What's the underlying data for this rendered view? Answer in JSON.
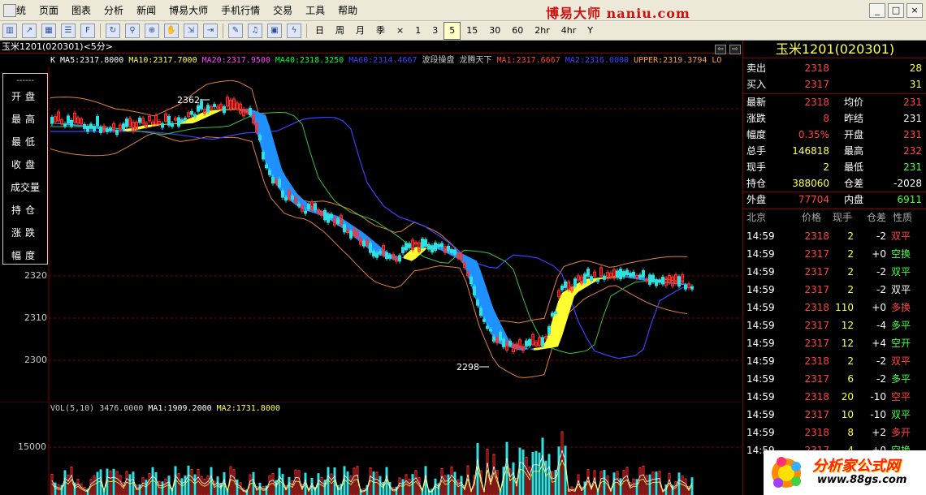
{
  "menu": [
    "系统",
    "页面",
    "图表",
    "分析",
    "新闻",
    "博易大师",
    "手机行情",
    "交易",
    "工具",
    "帮助"
  ],
  "brand": "博易大师 naniu.com",
  "window_buttons": [
    "_",
    "□",
    "×"
  ],
  "toolbar": {
    "icons": [
      "kline-icon",
      "trend-icon",
      "table-icon",
      "list-icon",
      "f10-icon",
      "refresh-icon",
      "search-icon",
      "zoom-icon",
      "hand-icon",
      "export-icon",
      "import-icon",
      "draw-icon",
      "alarm-icon",
      "grid-icon",
      "flash-icon"
    ],
    "periods": [
      "日",
      "周",
      "月",
      "季",
      "×",
      "1",
      "3",
      "5",
      "15",
      "30",
      "60",
      "2hr",
      "4hr",
      "Y"
    ],
    "active_period": "5"
  },
  "chart_header": "玉米1201(020301)<5分>",
  "indicators": [
    {
      "label": "K",
      "color": "#ffffff"
    },
    {
      "label": "MA5:2317.8000",
      "color": "#ffffff"
    },
    {
      "label": "MA10:2317.7000",
      "color": "#ffff50"
    },
    {
      "label": "MA20:2317.9500",
      "color": "#ff40ff"
    },
    {
      "label": "MA40:2318.3250",
      "color": "#00ff40"
    },
    {
      "label": "MA60:2314.4667",
      "color": "#4040ff"
    },
    {
      "label": "波段操盘",
      "color": "#c8c8c8"
    },
    {
      "label": "龙腾天下",
      "color": "#c8c8c8"
    },
    {
      "label": "MA1:2317.6667",
      "color": "#ff4040"
    },
    {
      "label": "MA2:2316.0000",
      "color": "#4040ff"
    },
    {
      "label": "UPPER:2319.3794",
      "color": "#ffa040"
    },
    {
      "label": "LO",
      "color": "#ffa040"
    }
  ],
  "infobox": {
    "dashes": "------",
    "items": [
      "开盘",
      "最高",
      "最低",
      "收盘",
      "成交量",
      "持仓",
      "涨跌",
      "幅度"
    ]
  },
  "y_axis_labels": [
    "2320",
    "2310",
    "2300"
  ],
  "volume_axis_label": "15000",
  "peak_label": "2362",
  "trough_label": "2298",
  "volume_legend": [
    {
      "label": "VOL(5,10)",
      "color": "#c8c8c8"
    },
    {
      "label": "3476.0000",
      "color": "#c8c8c8"
    },
    {
      "label": "MA1:1909.2000",
      "color": "#ffffff"
    },
    {
      "label": "MA2:1731.8000",
      "color": "#ffff50"
    }
  ],
  "quote": {
    "title": "玉米1201(020301)",
    "sell": {
      "label": "卖出",
      "price": "2318",
      "qty": "28"
    },
    "buy": {
      "label": "买入",
      "price": "2317",
      "qty": "31"
    },
    "rows": [
      {
        "l1": "最新",
        "v1": "2318",
        "l2": "均价",
        "v2": "231"
      },
      {
        "l1": "涨跌",
        "v1": "8",
        "l2": "昨结",
        "v2": "231"
      },
      {
        "l1": "幅度",
        "v1": "0.35%",
        "l2": "开盘",
        "v2": "231"
      },
      {
        "l1": "总手",
        "v1": "146818",
        "l2": "最高",
        "v2": "232"
      },
      {
        "l1": "现手",
        "v1": "2",
        "l2": "最低",
        "v2": "231"
      },
      {
        "l1": "持仓",
        "v1": "388060",
        "l2": "仓差",
        "v2": "-2028"
      }
    ],
    "outer": {
      "label": "外盘",
      "value": "77704",
      "label2": "内盘",
      "value2": "6911"
    }
  },
  "ticks_header": [
    "北京",
    "价格",
    "现手",
    "仓差",
    "性质"
  ],
  "ticks": [
    {
      "time": "14:59",
      "price": "2318",
      "vol": "2",
      "chg": "-2",
      "type": "双平",
      "pc": "#ff4040",
      "tc": "#ff4040"
    },
    {
      "time": "14:59",
      "price": "2317",
      "vol": "2",
      "chg": "+0",
      "type": "空换",
      "pc": "#ff4040",
      "tc": "#40ff40"
    },
    {
      "time": "14:59",
      "price": "2317",
      "vol": "2",
      "chg": "-2",
      "type": "双平",
      "pc": "#ff4040",
      "tc": "#40ff40"
    },
    {
      "time": "14:59",
      "price": "2317",
      "vol": "2",
      "chg": "-2",
      "type": "双平",
      "pc": "#ff4040",
      "tc": "#ffffff"
    },
    {
      "time": "14:59",
      "price": "2318",
      "vol": "110",
      "chg": "+0",
      "type": "多换",
      "pc": "#ff4040",
      "tc": "#ff4040"
    },
    {
      "time": "14:59",
      "price": "2317",
      "vol": "12",
      "chg": "-4",
      "type": "多平",
      "pc": "#ff4040",
      "tc": "#40ff40"
    },
    {
      "time": "14:59",
      "price": "2317",
      "vol": "12",
      "chg": "+4",
      "type": "空开",
      "pc": "#ff4040",
      "tc": "#40ff40"
    },
    {
      "time": "14:59",
      "price": "2318",
      "vol": "2",
      "chg": "-2",
      "type": "双平",
      "pc": "#ff4040",
      "tc": "#ff4040"
    },
    {
      "time": "14:59",
      "price": "2317",
      "vol": "6",
      "chg": "-2",
      "type": "多平",
      "pc": "#ff4040",
      "tc": "#40ff40"
    },
    {
      "time": "14:59",
      "price": "2318",
      "vol": "20",
      "chg": "-10",
      "type": "空平",
      "pc": "#ff4040",
      "tc": "#ff4040"
    },
    {
      "time": "14:59",
      "price": "2317",
      "vol": "10",
      "chg": "-10",
      "type": "双平",
      "pc": "#ff4040",
      "tc": "#40ff40"
    },
    {
      "time": "14:59",
      "price": "2318",
      "vol": "8",
      "chg": "+2",
      "type": "多开",
      "pc": "#ff4040",
      "tc": "#ff4040"
    },
    {
      "time": "14:59",
      "price": "2317",
      "vol": "4",
      "chg": "+0",
      "type": "空换",
      "pc": "#ff4040",
      "tc": "#40ff40"
    }
  ],
  "watermark": {
    "text": "分析家公式网",
    "url": "www.88gs.com"
  }
}
